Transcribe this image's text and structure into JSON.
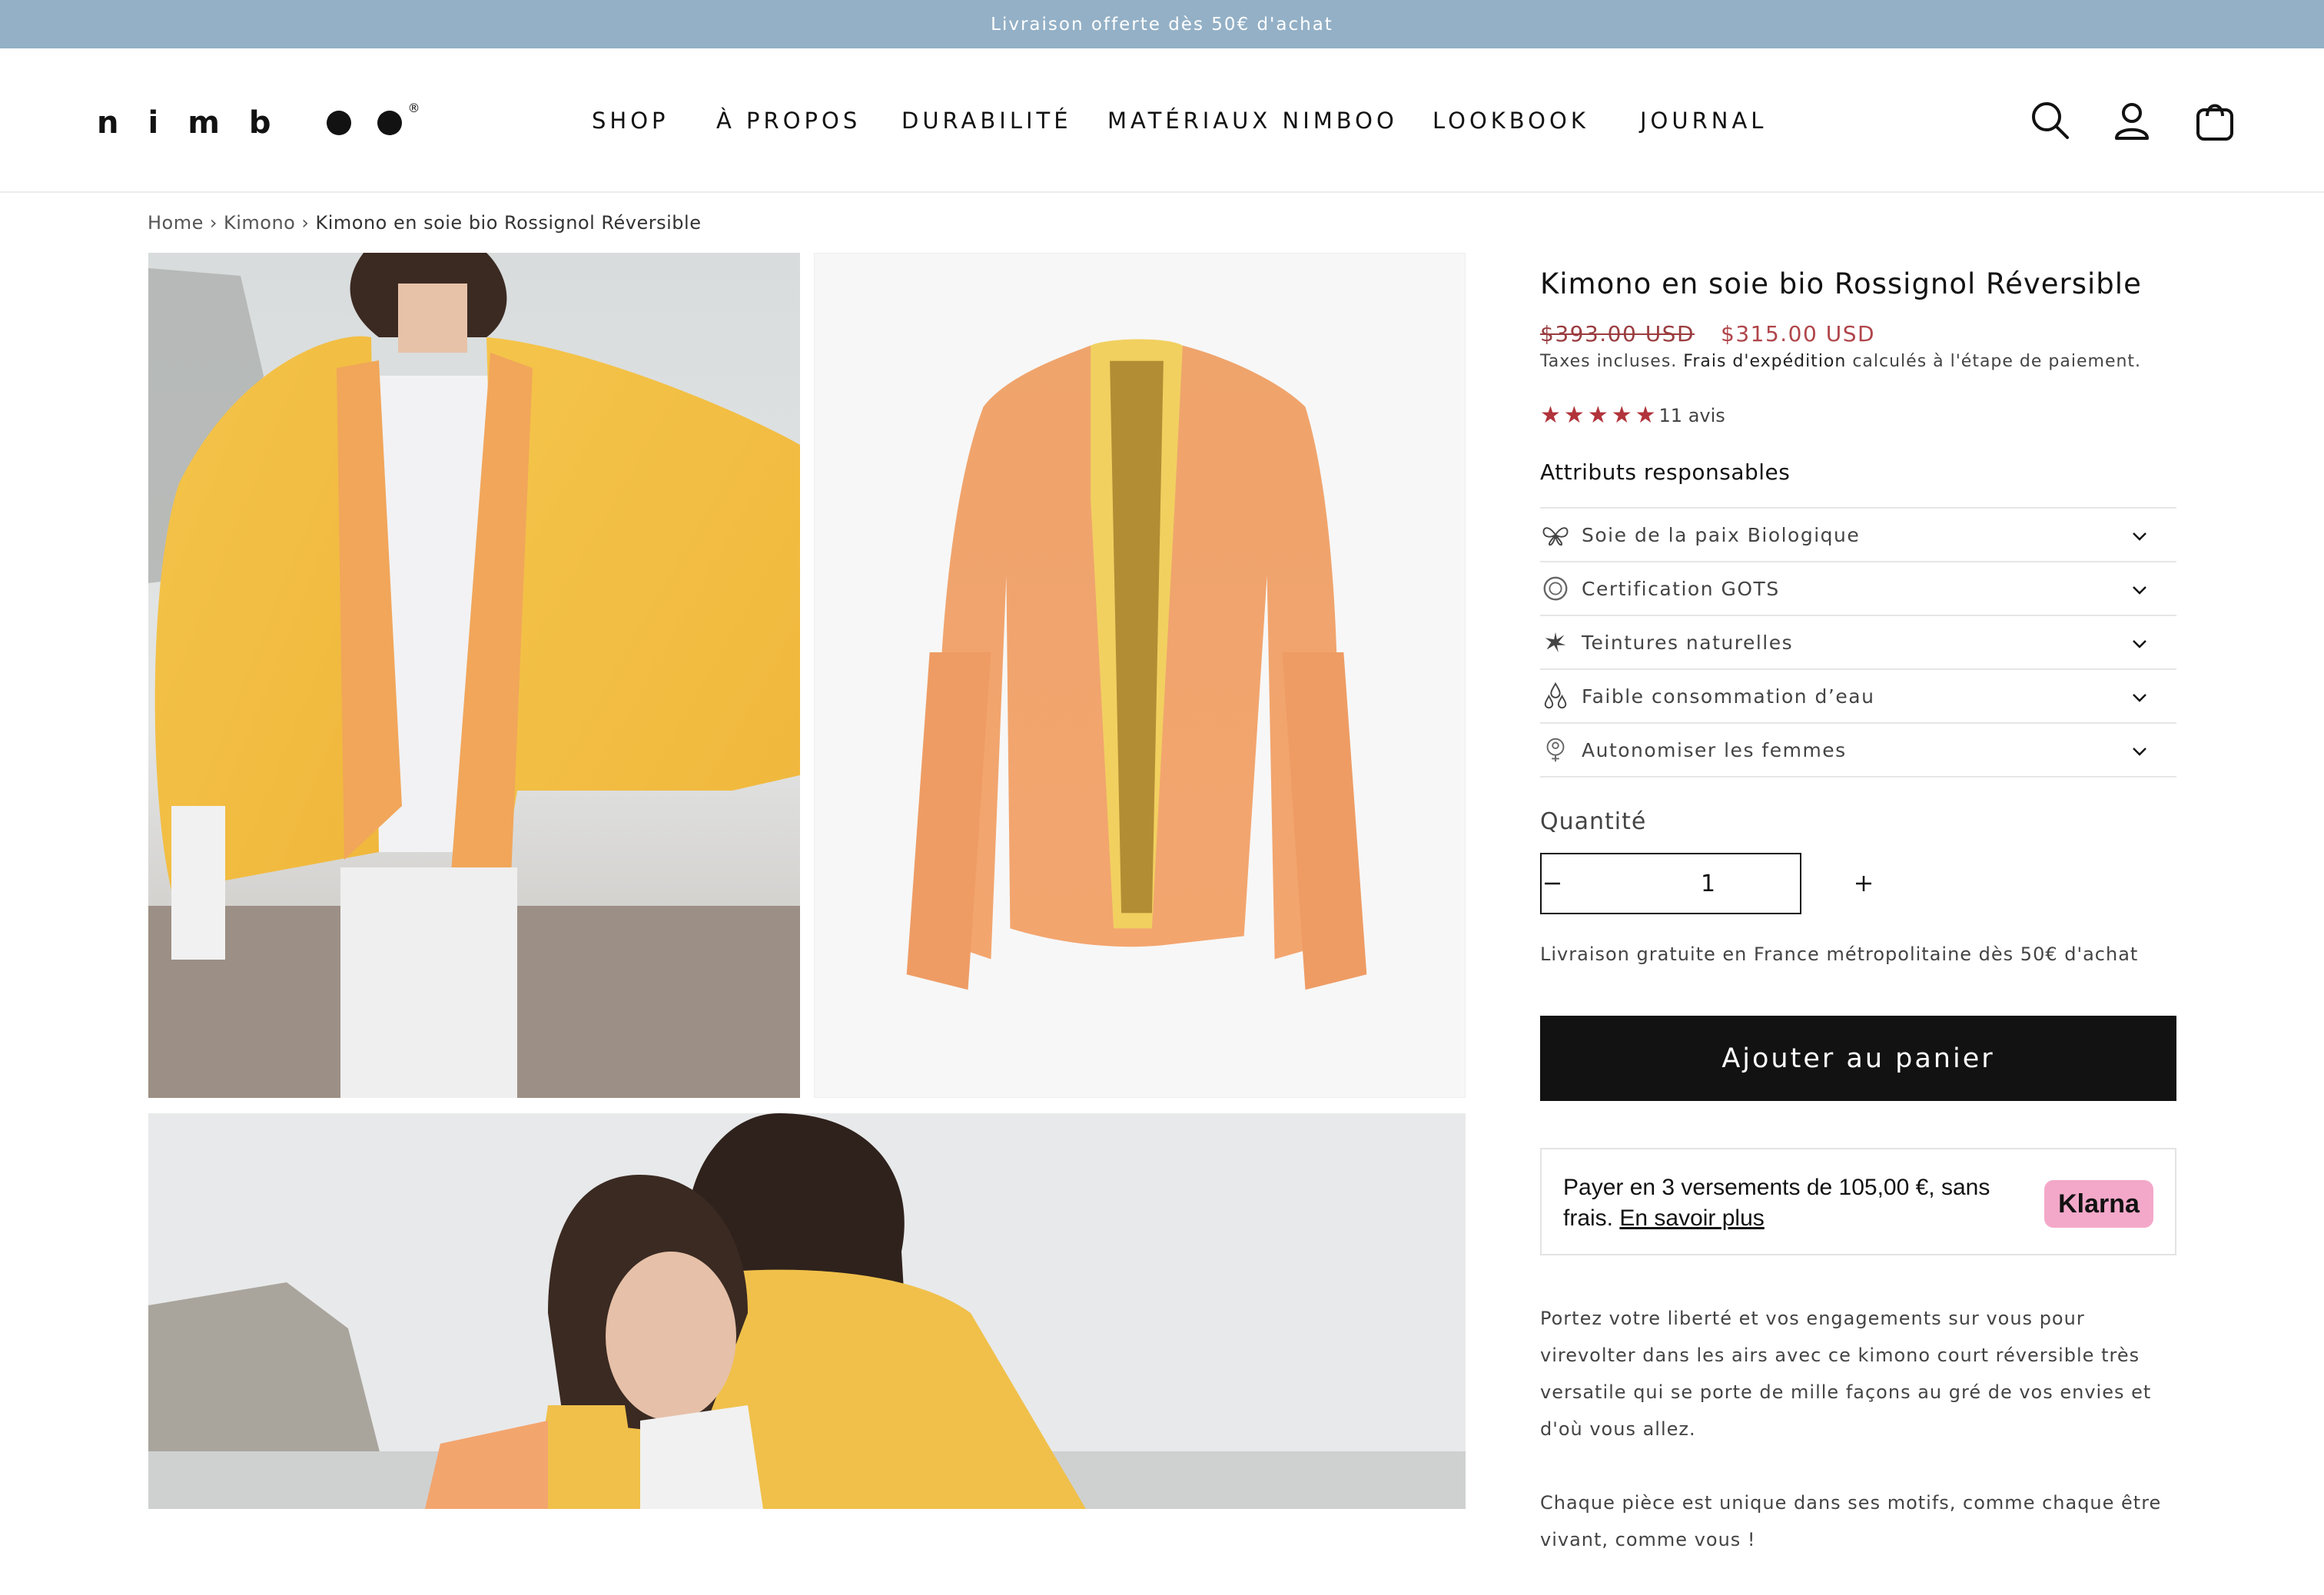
{
  "announcement": "Livraison offerte dès 50€ d'achat",
  "logo": {
    "text": "nimboo",
    "reg": "®"
  },
  "nav": [
    {
      "label": "SHOP"
    },
    {
      "label": "À PROPOS"
    },
    {
      "label": "DURABILITÉ"
    },
    {
      "label": "MATÉRIAUX NIMBOO"
    },
    {
      "label": "LOOKBOOK"
    },
    {
      "label": "JOURNAL"
    }
  ],
  "header_icons": [
    "search-icon",
    "account-icon",
    "cart-icon"
  ],
  "breadcrumb": {
    "home": "Home",
    "sep": "›",
    "category": "Kimono",
    "current": "Kimono en soie bio Rossignol Réversible"
  },
  "product": {
    "title": "Kimono en soie bio Rossignol Réversible",
    "price_old": "$393.00 USD",
    "price_new": "$315.00 USD",
    "tax_prefix": "Taxes incluses.",
    "tax_link": "Frais d'expédition",
    "tax_suffix": "calculés à l'étape de paiement.",
    "rating_stars": 5,
    "reviews": "11 avis",
    "attributes_title": "Attributs responsables",
    "attributes": [
      {
        "label": "Soie de la paix Biologique",
        "icon": "butterfly-icon"
      },
      {
        "label": "Certification GOTS",
        "icon": "gots-icon"
      },
      {
        "label": "Teintures naturelles",
        "icon": "leaf-icon"
      },
      {
        "label": "Faible consommation d’eau",
        "icon": "water-drops-icon"
      },
      {
        "label": "Autonomiser les femmes",
        "icon": "woman-icon"
      }
    ],
    "quantity_label": "Quantité",
    "quantity": "1",
    "shipping_note": "Livraison gratuite en France métropolitaine dès 50€ d'achat",
    "add_to_cart": "Ajouter au panier",
    "klarna": {
      "text": "Payer en 3 versements de 105,00 €, sans frais.",
      "link": "En savoir plus",
      "badge": "Klarna"
    },
    "description": [
      "Portez votre liberté et vos engagements sur vous pour virevolter dans les airs avec ce kimono court réversible très versatile qui se porte de mille façons au gré de vos envies et d'où vous allez.",
      "Chaque pièce est unique dans ses motifs, comme chaque être vivant, comme vous !"
    ]
  },
  "colors": {
    "announcement_bg": "#93b0c6",
    "price": "#b0454a",
    "stars": "#b1343b",
    "button_bg": "#121212",
    "klarna": "#f3a8c9"
  }
}
